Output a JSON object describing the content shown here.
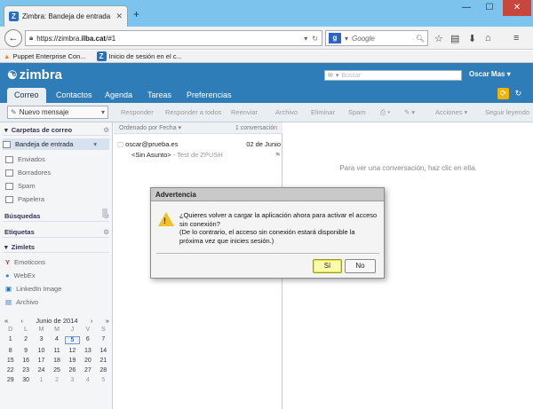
{
  "browser": {
    "tab_title": "Zimbra: Bandeja de entrada",
    "url_prefix": "https://zimbra.",
    "url_domain": "ilba.cat",
    "url_suffix": "/#1",
    "search_placeholder": "Google",
    "bookmarks": [
      {
        "label": "Puppet Enterprise Con..."
      },
      {
        "label": "Inicio de sesión en el c..."
      }
    ]
  },
  "zimbra": {
    "logo": "zimbra",
    "search_placeholder": "Buscar",
    "user": "Oscar Mas",
    "tabs": [
      {
        "label": "Correo"
      },
      {
        "label": "Contactos"
      },
      {
        "label": "Agenda"
      },
      {
        "label": "Tareas"
      },
      {
        "label": "Preferencias"
      }
    ],
    "toolbar": {
      "new_message": "Nuevo mensaje",
      "actions": [
        "Responder",
        "Responder a todos",
        "Reenviar",
        "Archivo",
        "Eliminar",
        "Spam",
        "Acciones",
        "Seguir leyendo"
      ]
    }
  },
  "sidebar": {
    "folders_header": "Carpetas de correo",
    "folders": [
      {
        "label": "Bandeja de entrada"
      },
      {
        "label": "Enviados"
      },
      {
        "label": "Borradores"
      },
      {
        "label": "Spam"
      },
      {
        "label": "Papelera"
      }
    ],
    "searches_header": "Búsquedas",
    "tags_header": "Etiquetas",
    "zimlets_header": "Zimlets",
    "zimlets": [
      {
        "label": "Emoticons"
      },
      {
        "label": "WebEx"
      },
      {
        "label": "LinkedIn Image"
      },
      {
        "label": "Archivo"
      }
    ]
  },
  "calendar": {
    "month": "Junio de 2014",
    "dow": [
      "D",
      "L",
      "M",
      "M",
      "J",
      "V",
      "S"
    ],
    "days": [
      "1",
      "2",
      "3",
      "4",
      "5",
      "6",
      "7",
      "8",
      "9",
      "10",
      "11",
      "12",
      "13",
      "14",
      "15",
      "16",
      "17",
      "18",
      "19",
      "20",
      "21",
      "22",
      "23",
      "24",
      "25",
      "26",
      "27",
      "28",
      "29",
      "30",
      "1",
      "2",
      "3",
      "4",
      "5"
    ],
    "today": "5"
  },
  "list": {
    "sort_label": "Ordenado por Fecha",
    "count": "1 conversación",
    "message": {
      "from": "oscar@prueba.es",
      "date": "02 de Junio",
      "subject": "<Sin Asunto>",
      "preview": "- Test de ZPUSH"
    }
  },
  "reading_pane": {
    "hint": "Para ver una conversación, haz clic en ella."
  },
  "dialog": {
    "title": "Advertencia",
    "line1": "¿Quieres volver a cargar la aplicación ahora para activar el acceso sin conexión?",
    "line2": "(De lo contrario, el acceso sin conexión estará disponible la próxima vez que inicies sesión.)",
    "yes": "Sí",
    "no": "No"
  },
  "colors": {
    "zimbra_blue": "#2e7cb8",
    "warning_yellow": "#f0c22a",
    "focused_button": "#fafab0"
  }
}
